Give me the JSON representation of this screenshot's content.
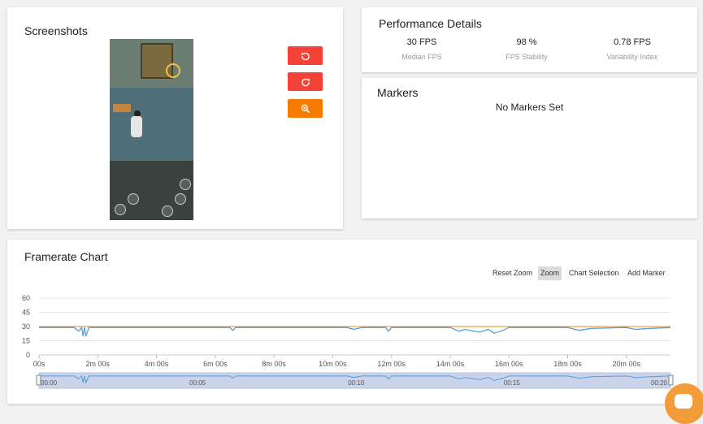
{
  "screenshots": {
    "title": "Screenshots",
    "buttons": [
      {
        "name": "rotate-left",
        "color": "#f44336"
      },
      {
        "name": "rotate-right",
        "color": "#f44336"
      },
      {
        "name": "zoom-in",
        "color": "#f57c00"
      }
    ]
  },
  "performance": {
    "title": "Performance Details",
    "stats": [
      {
        "value": "30 FPS",
        "label": "Median FPS"
      },
      {
        "value": "98 %",
        "label": "FPS Stability"
      },
      {
        "value": "0.78 FPS",
        "label": "Variability Index"
      }
    ]
  },
  "markers": {
    "title": "Markers",
    "empty_text": "No Markers Set"
  },
  "framerate": {
    "title": "Framerate Chart",
    "toolbar": [
      "Reset Zoom",
      "Zoom",
      "Chart Selection",
      "Add Marker"
    ],
    "active_tool": "Zoom"
  },
  "colors": {
    "accent_red": "#f44336",
    "accent_orange": "#f57c00",
    "series_blue": "#5b9bd5",
    "series_orange": "#f0a040"
  },
  "chart_data": {
    "type": "line",
    "title": "Framerate Chart",
    "xlabel": "",
    "ylabel": "",
    "ylim": [
      0,
      60
    ],
    "xlim_minutes": [
      0,
      21.5
    ],
    "y_ticks": [
      "0",
      "15",
      "30",
      "45",
      "60"
    ],
    "x_ticks": [
      "00s",
      "2m 00s",
      "4m 00s",
      "6m 00s",
      "8m 00s",
      "10m 00s",
      "12m 00s",
      "14m 00s",
      "16m 00s",
      "18m 00s",
      "20m 00s"
    ],
    "navigator_ticks": [
      "00:00",
      "00:05",
      "00:10",
      "00:15",
      "00:20"
    ],
    "grid": true,
    "series": [
      {
        "color": "#5b9bd5",
        "x": [
          0,
          1.2,
          1.35,
          1.45,
          1.5,
          1.55,
          1.6,
          1.7,
          1.8,
          2,
          4,
          6.5,
          6.6,
          6.7,
          8,
          10.5,
          10.7,
          11,
          11.8,
          11.9,
          12,
          12.5,
          14,
          14.3,
          14.5,
          15,
          15.3,
          15.5,
          15.8,
          16,
          18,
          18.4,
          18.8,
          20,
          20.3,
          20.8,
          21.5
        ],
        "y": [
          29,
          29,
          25,
          29,
          20,
          29,
          20,
          29,
          29,
          29,
          29,
          29,
          26,
          29,
          29,
          29,
          27,
          29,
          29,
          25,
          29,
          29,
          29,
          25,
          27,
          24,
          27,
          23,
          26,
          29,
          29,
          26,
          28,
          29,
          27,
          28,
          29
        ]
      },
      {
        "color": "#f0a040",
        "x": [
          0,
          21.5
        ],
        "y": [
          30,
          30
        ]
      }
    ]
  }
}
